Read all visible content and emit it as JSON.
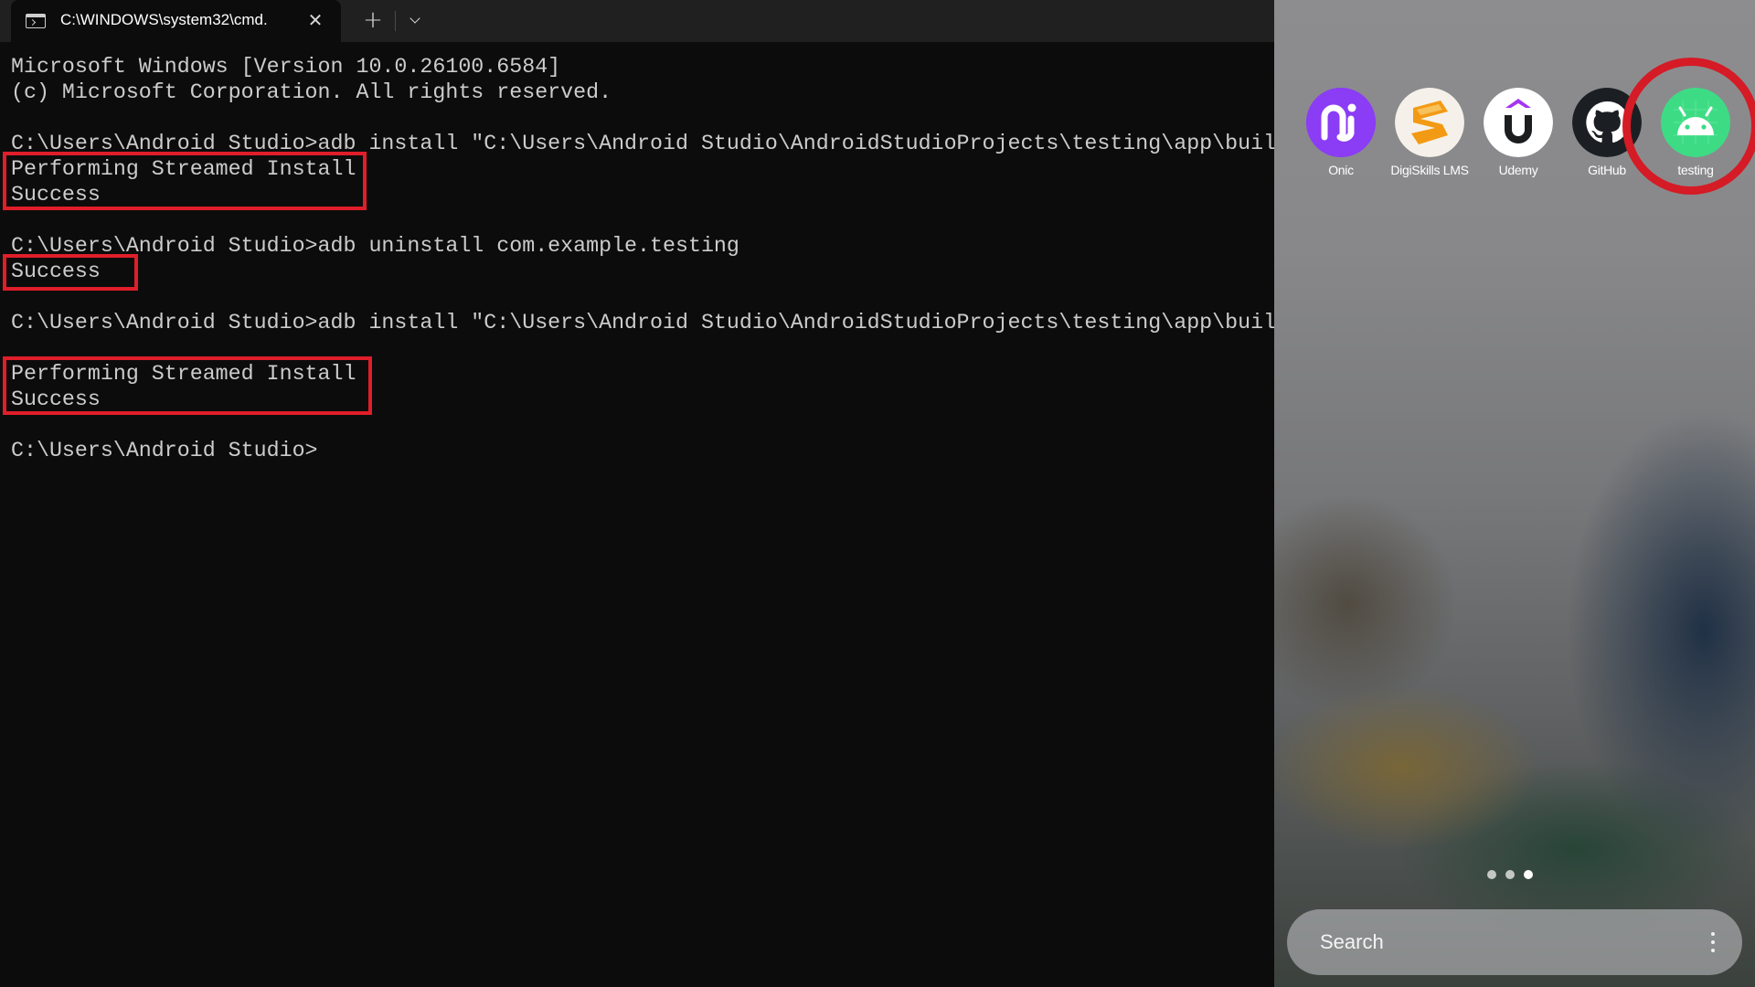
{
  "terminal": {
    "tab_title": "C:\\WINDOWS\\system32\\cmd.",
    "tab_icon": "terminal-icon",
    "close_icon": "close-icon",
    "new_tab_icon": "plus-icon",
    "dropdown_icon": "chevron-down-icon",
    "lines": [
      "Microsoft Windows [Version 10.0.26100.6584]",
      "(c) Microsoft Corporation. All rights reserved.",
      "C:\\Users\\Android Studio>adb install \"C:\\Users\\Android Studio\\AndroidStudioProjects\\testing\\app\\buil",
      "Performing Streamed Install",
      "Success",
      "C:\\Users\\Android Studio>adb uninstall com.example.testing",
      "Success",
      "C:\\Users\\Android Studio>adb install \"C:\\Users\\Android Studio\\AndroidStudioProjects\\testing\\app\\buil",
      "Performing Streamed Install",
      "Success",
      "C:\\Users\\Android Studio>"
    ],
    "highlight_color": "#e01e2a"
  },
  "phone": {
    "apps": [
      {
        "label": "Onic",
        "icon": "onic-icon",
        "color": "#8b3cf5"
      },
      {
        "label": "DigiSkills LMS",
        "icon": "digiskills-icon",
        "color": "#f39a14"
      },
      {
        "label": "Udemy",
        "icon": "udemy-icon",
        "color": "#ffffff"
      },
      {
        "label": "GitHub",
        "icon": "github-icon",
        "color": "#1b1f23"
      },
      {
        "label": "testing",
        "icon": "android-icon",
        "color": "#3ddc84"
      }
    ],
    "highlight_color": "#d51b26",
    "page_count": 3,
    "current_page": 3,
    "search_placeholder": "Search",
    "menu_icon": "more-vertical-icon"
  }
}
